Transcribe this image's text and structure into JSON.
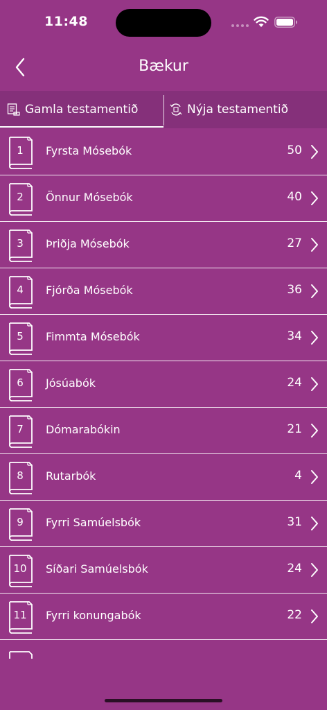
{
  "status_bar": {
    "time": "11:48"
  },
  "nav": {
    "title": "Bækur"
  },
  "tabs": [
    {
      "label": "Gamla testamentið",
      "selected": true,
      "icon": "old-testament-icon"
    },
    {
      "label": "Nýja testamentið",
      "selected": false,
      "icon": "new-testament-icon"
    }
  ],
  "books": [
    {
      "number": "1",
      "name": "Fyrsta Mósebók",
      "chapters": "50"
    },
    {
      "number": "2",
      "name": "Önnur Mósebók",
      "chapters": "40"
    },
    {
      "number": "3",
      "name": "Þriðja Mósebók",
      "chapters": "27"
    },
    {
      "number": "4",
      "name": "Fjórða Mósebók",
      "chapters": "36"
    },
    {
      "number": "5",
      "name": "Fimmta Mósebók",
      "chapters": "34"
    },
    {
      "number": "6",
      "name": "Jósúabók",
      "chapters": "24"
    },
    {
      "number": "7",
      "name": "Dómarabókin",
      "chapters": "21"
    },
    {
      "number": "8",
      "name": "Rutarbók",
      "chapters": "4"
    },
    {
      "number": "9",
      "name": "Fyrri Samúelsbók",
      "chapters": "31"
    },
    {
      "number": "10",
      "name": "Síðari Samúelsbók",
      "chapters": "24"
    },
    {
      "number": "11",
      "name": "Fyrri konungabók",
      "chapters": "22"
    }
  ],
  "colors": {
    "background": "#963686",
    "tab_bar": "#85307a",
    "text": "#ffffff"
  }
}
